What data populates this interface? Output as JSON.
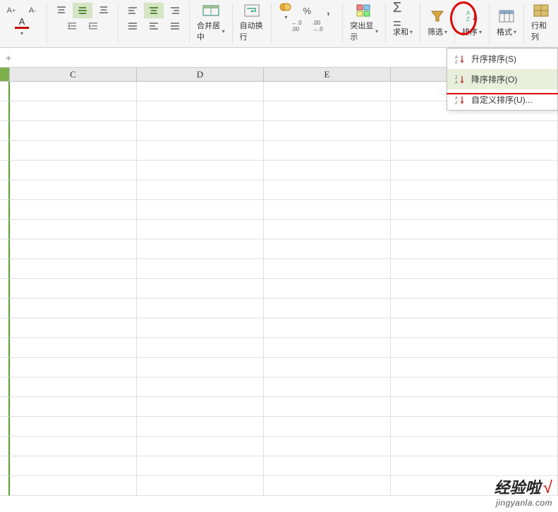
{
  "ribbon": {
    "font_inc": "A⁺",
    "font_dec": "A⁻",
    "merge_label": "合并居中",
    "wrap_label": "自动换行",
    "percent": "%",
    "comma": ",",
    "dec_inc": ".0 .00",
    "dec_dec": ".00 .0",
    "highlight_label": "突出显示",
    "sum_label": "求和",
    "filter_label": "筛选",
    "sort_label": "排序",
    "format_label": "格式",
    "rowcol_label": "行和列"
  },
  "menu": {
    "asc": "升序排序(S)",
    "desc": "降序排序(O)",
    "custom": "自定义排序(U)..."
  },
  "columns": {
    "c": "C",
    "d": "D",
    "e": "E"
  },
  "watermark": {
    "main": "经验啦",
    "check": "√",
    "sub": "jingyanla.com"
  }
}
